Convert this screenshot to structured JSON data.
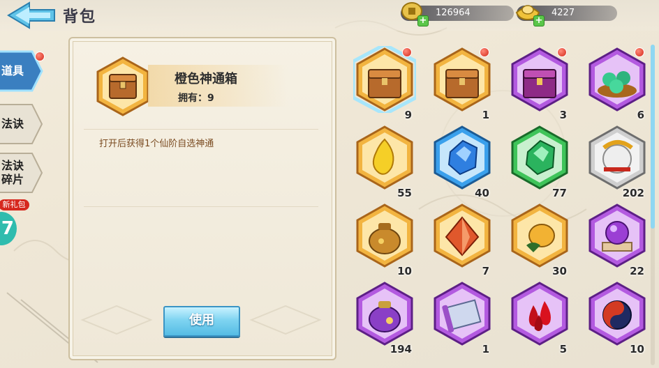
{
  "header": {
    "title": "背包",
    "coins": "126964",
    "ingots": "4227",
    "currency_icons": [
      "coin-icon",
      "gold-ingot-icon"
    ]
  },
  "tabs": [
    {
      "label": "道具",
      "active": true,
      "has_dot": true
    },
    {
      "label": "法诀",
      "active": false,
      "has_dot": false
    },
    {
      "label": "法诀碎片",
      "label_line1": "法诀",
      "label_line2": "碎片",
      "active": false,
      "has_dot": false
    }
  ],
  "promo": {
    "badge": "新礼包",
    "number": "7"
  },
  "detail": {
    "name": "橙色神通箱",
    "owned_label": "拥有：",
    "owned_count": "9",
    "description": "打开后获得1个仙阶自选神通",
    "use_button": "使用",
    "icon": "wooden-chest-icon"
  },
  "colors": {
    "orange": "#e89a22",
    "purple": "#9d3fc8",
    "blue": "#2f8fd9",
    "green": "#32b04a",
    "silver": "#b9b9b9",
    "accent_button": "#55bce4",
    "red_dot": "#d42a1a"
  },
  "items": [
    {
      "icon": "wooden-chest-icon",
      "frame": "orange",
      "count": "9",
      "dot": true,
      "selected": true
    },
    {
      "icon": "wooden-chest-icon",
      "frame": "orange",
      "count": "1",
      "dot": true
    },
    {
      "icon": "purple-chest-icon",
      "frame": "purple",
      "count": "3",
      "dot": true
    },
    {
      "icon": "jade-beads-icon",
      "frame": "purple",
      "count": "6",
      "dot": true
    },
    {
      "icon": "golden-flame-stone-icon",
      "frame": "orange",
      "count": "55"
    },
    {
      "icon": "blue-crystal-icon",
      "frame": "blue",
      "count": "40"
    },
    {
      "icon": "green-crystal-icon",
      "frame": "green",
      "count": "77"
    },
    {
      "icon": "dragon-orb-icon",
      "frame": "silver",
      "count": "202"
    },
    {
      "icon": "gold-pouch-icon",
      "frame": "orange",
      "count": "10"
    },
    {
      "icon": "red-gem-icon",
      "frame": "orange",
      "count": "7"
    },
    {
      "icon": "golden-fruit-icon",
      "frame": "orange",
      "count": "30"
    },
    {
      "icon": "purple-orb-pedestal-icon",
      "frame": "purple",
      "count": "22"
    },
    {
      "icon": "purple-pouch-icon",
      "frame": "purple",
      "count": "194"
    },
    {
      "icon": "scroll-map-icon",
      "frame": "purple",
      "count": "1"
    },
    {
      "icon": "blood-drops-icon",
      "frame": "purple",
      "count": "5"
    },
    {
      "icon": "taiji-orb-icon",
      "frame": "purple",
      "count": "10"
    }
  ]
}
